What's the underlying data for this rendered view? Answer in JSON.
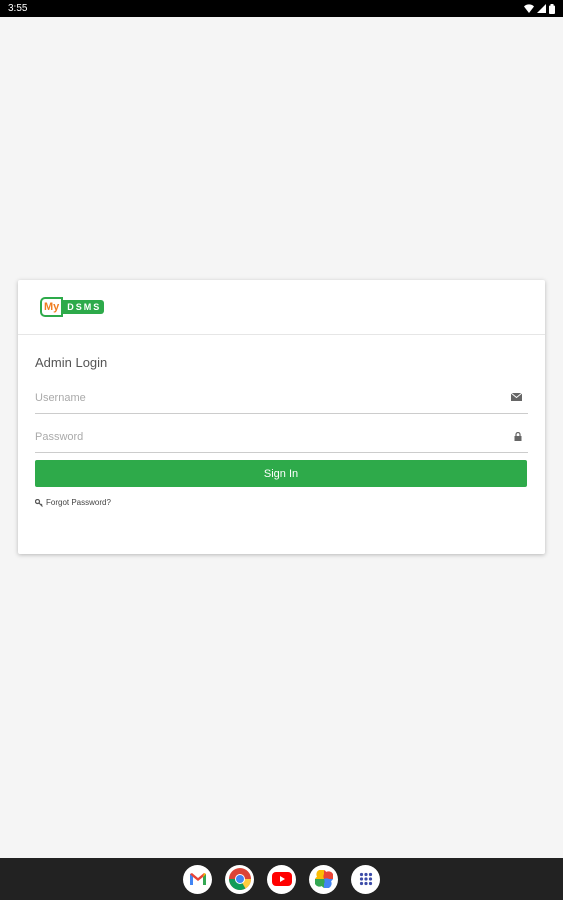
{
  "status_bar": {
    "time": "3:55"
  },
  "logo": {
    "part1": "My",
    "part2": "DSMS"
  },
  "login": {
    "title": "Admin Login",
    "username_placeholder": "Username",
    "password_placeholder": "Password",
    "signin_label": "Sign In",
    "forgot_label": "Forgot Password?"
  },
  "dock": {
    "apps": [
      "gmail-icon",
      "chrome-icon",
      "youtube-icon",
      "photos-icon",
      "app-drawer-icon"
    ]
  },
  "colors": {
    "brand_green": "#2eaa4a",
    "brand_orange": "#f07c1e",
    "background": "#f5f5f5"
  }
}
